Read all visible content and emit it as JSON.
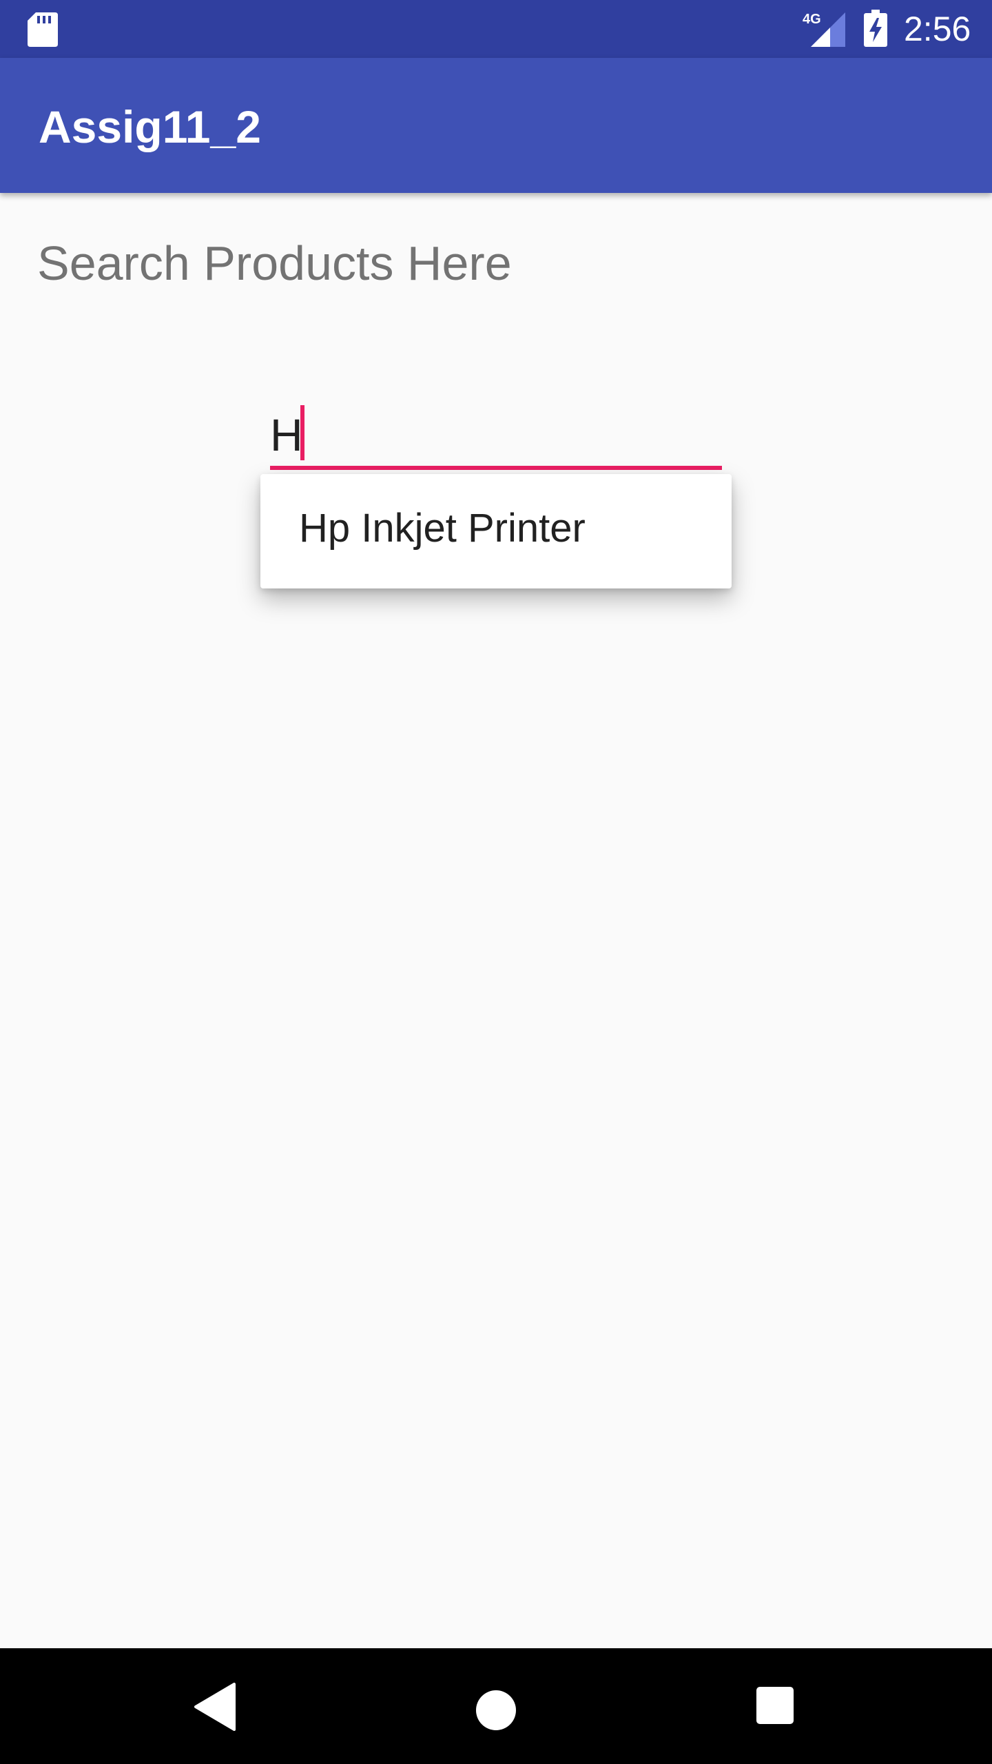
{
  "status_bar": {
    "time": "2:56",
    "network_label": "4G",
    "icons": [
      "sd-card-icon",
      "signal-icon",
      "battery-charging-icon"
    ]
  },
  "app_bar": {
    "title": "Assig11_2"
  },
  "main": {
    "search_label": "Search Products Here",
    "search_input": {
      "value": "H"
    },
    "suggestions": [
      {
        "label": "Hp Inkjet Printer"
      }
    ]
  },
  "nav_bar": {
    "buttons": [
      "back-icon",
      "home-icon",
      "recents-icon"
    ]
  },
  "colors": {
    "status_bar": "#303f9f",
    "app_bar": "#3f51b5",
    "accent": "#e91e63",
    "background": "#fafafa"
  }
}
